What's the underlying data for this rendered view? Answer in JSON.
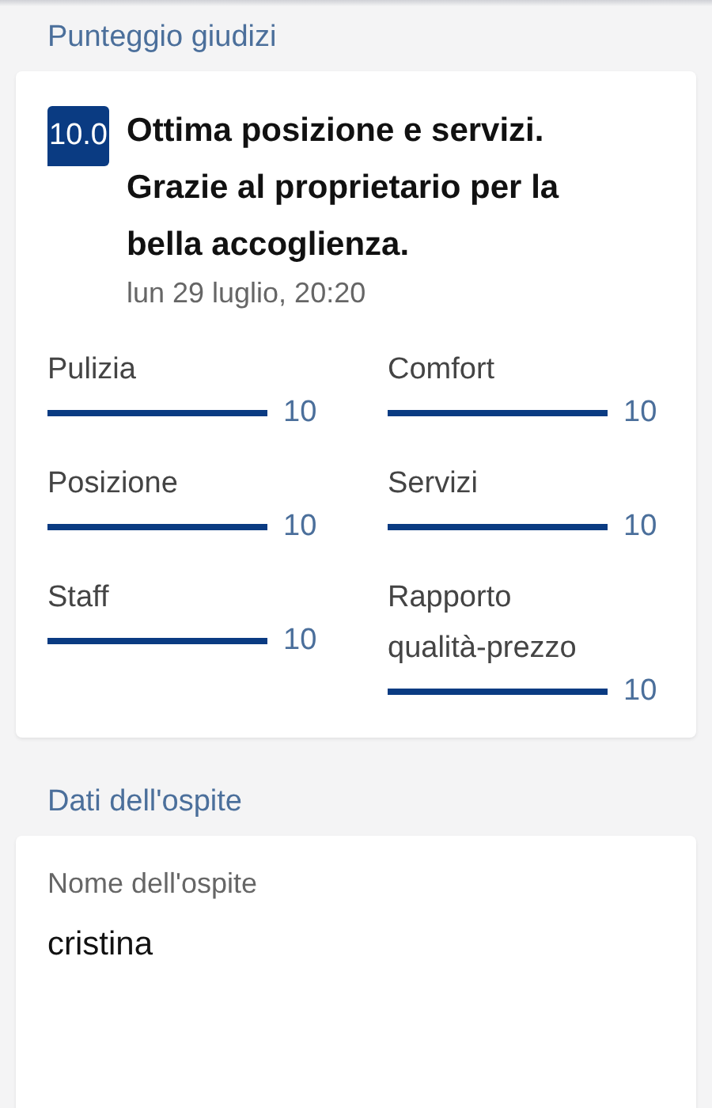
{
  "review_section": {
    "title": "Punteggio giudizi",
    "review": {
      "score": "10.0",
      "headline": "Ottima posizione e servizi. Grazie al proprietario per la bella accoglienza.",
      "date": "lun 29 luglio, 20:20"
    },
    "categories": [
      {
        "label": "Pulizia",
        "level": 1,
        "reading": "10"
      },
      {
        "label": "Comfort",
        "level": 1,
        "reading": "10"
      },
      {
        "label": "Posizione",
        "level": 1,
        "reading": "10"
      },
      {
        "label": "Servizi",
        "level": 1,
        "reading": "10"
      },
      {
        "label": "Staff",
        "level": 1,
        "reading": "10"
      },
      {
        "label": "Rapporto qualità-prezzo",
        "level": 1,
        "reading": "10"
      }
    ]
  },
  "guest_section": {
    "title": "Dati dell'ospite",
    "fields": [
      {
        "label": "Nome dell'ospite",
        "value": "cristina"
      }
    ]
  }
}
